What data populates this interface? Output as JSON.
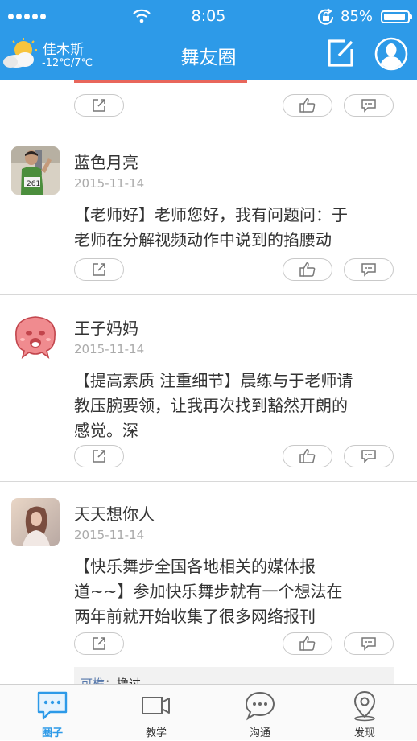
{
  "status_bar": {
    "time": "8:05",
    "battery": "85%"
  },
  "weather": {
    "city": "佳木斯",
    "temp": "-12℃/7℃"
  },
  "header": {
    "title": "舞友圈"
  },
  "posts": [
    {
      "name": "蓝色月亮",
      "date": "2015-11-14",
      "lines": [
        "【老师好】老师您好，我有问题问：于",
        "老师在分解视频动作中说到的掐腰动"
      ]
    },
    {
      "name": "王子妈妈",
      "date": "2015-11-14",
      "lines": [
        "【提高素质 注重细节】晨练与于老师请",
        "教压腕要领，让我再次找到豁然开朗的",
        "感觉。深"
      ]
    },
    {
      "name": "天天想你人",
      "date": "2015-11-14",
      "lines": [
        "【快乐舞步全国各地相关的媒体报",
        "道~~】参加快乐舞步就有一个想法在",
        "两年前就开始收集了很多网络报刊"
      ]
    }
  ],
  "quote": {
    "author": "可樵",
    "text": "：撸过"
  },
  "tabs": [
    {
      "label": "圈子",
      "icon": "chat-bubble-icon",
      "active": true
    },
    {
      "label": "教学",
      "icon": "video-camera-icon",
      "active": false
    },
    {
      "label": "沟通",
      "icon": "speech-bubble-icon",
      "active": false
    },
    {
      "label": "发现",
      "icon": "location-pin-icon",
      "active": false
    }
  ],
  "colors": {
    "header": "#2d9ae8",
    "accent_bar": "#e8665b",
    "active_tab": "#2d9ae8"
  }
}
